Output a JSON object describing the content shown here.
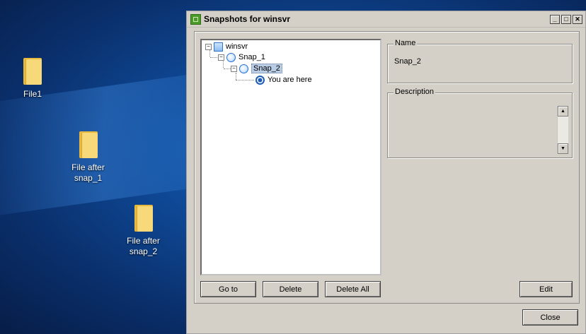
{
  "desktop": {
    "icons": [
      {
        "label": "File1"
      },
      {
        "label": "File after snap_1"
      },
      {
        "label": "File after snap_2"
      }
    ]
  },
  "window": {
    "title": "Snapshots for winsvr",
    "controls": {
      "minimize": "_",
      "maximize": "□",
      "close": "✕"
    }
  },
  "tree": {
    "root": "winsvr",
    "snap1": "Snap_1",
    "snap2": "Snap_2",
    "current": "You are here",
    "expander": "−"
  },
  "buttons": {
    "goto": "Go to",
    "delete": "Delete",
    "delete_all": "Delete All",
    "edit": "Edit",
    "close": "Close"
  },
  "details": {
    "name_label": "Name",
    "name_value": "Snap_2",
    "description_label": "Description",
    "scroll_up": "▲",
    "scroll_down": "▼"
  }
}
